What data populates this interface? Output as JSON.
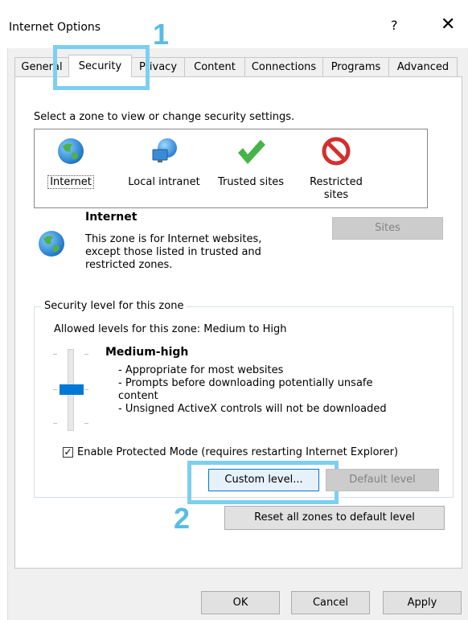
{
  "window": {
    "title": "Internet Options",
    "help_label": "?",
    "close_label": "✕"
  },
  "tabs": [
    {
      "label": "General"
    },
    {
      "label": "Security"
    },
    {
      "label": "Privacy"
    },
    {
      "label": "Content"
    },
    {
      "label": "Connections"
    },
    {
      "label": "Programs"
    },
    {
      "label": "Advanced"
    }
  ],
  "active_tab": "Security",
  "zones": {
    "prompt": "Select a zone to view or change security settings.",
    "items": [
      {
        "label": "Internet",
        "icon": "globe-icon"
      },
      {
        "label": "Local intranet",
        "icon": "intranet-globe-icon"
      },
      {
        "label": "Trusted sites",
        "icon": "checkmark-icon"
      },
      {
        "label": "Restricted sites",
        "icon": "restricted-icon"
      }
    ],
    "selected": "Internet"
  },
  "zone_info": {
    "title": "Internet",
    "description": "This zone is for Internet websites, except those listed in trusted and restricted zones.",
    "sites_button": "Sites"
  },
  "security_level": {
    "group_label": "Security level for this zone",
    "allowed": "Allowed levels for this zone: Medium to High",
    "level_name": "Medium-high",
    "bullets": [
      "- Appropriate for most websites",
      "- Prompts before downloading potentially unsafe content",
      "- Unsigned ActiveX controls will not be downloaded"
    ],
    "protected_mode_label": "Enable Protected Mode (requires restarting Internet Explorer)",
    "protected_mode_checked": true,
    "custom_level_button": "Custom level...",
    "default_level_button": "Default level"
  },
  "reset_button": "Reset all zones to default level",
  "footer": {
    "ok": "OK",
    "cancel": "Cancel",
    "apply": "Apply"
  },
  "annotations": {
    "step1": "1",
    "step2": "2",
    "highlight_color": "#7dcff0"
  }
}
